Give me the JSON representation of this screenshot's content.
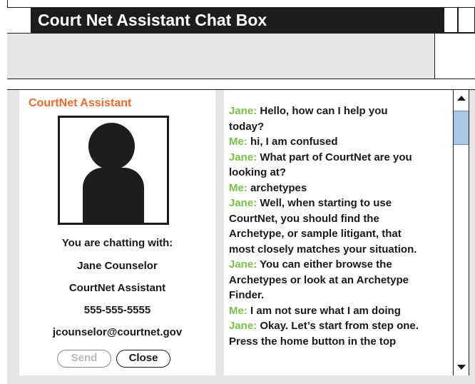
{
  "window": {
    "title": "Court Net Assistant Chat Box"
  },
  "assistant_panel": {
    "label": "CourtNet Assistant",
    "avatar_icon": "person-silhouette-icon",
    "chatting_with_label": "You are chatting with:",
    "name": "Jane Counselor",
    "role": "CourtNet Assistant",
    "phone": "555-555-5555",
    "email": "jcounselor@courtnet.gov",
    "send_label": "Send",
    "close_label": "Close",
    "send_enabled": false
  },
  "chat": {
    "lines": [
      {
        "speaker": "Jane:",
        "text": " Hello, how can I help you"
      },
      {
        "speaker": "",
        "text": "today?"
      },
      {
        "speaker": "Me:",
        "text": " hi, I am confused"
      },
      {
        "speaker": "Jane:",
        "text": " What part of CourtNet are you"
      },
      {
        "speaker": "",
        "text": "looking at?"
      },
      {
        "speaker": "Me:",
        "text": " archetypes"
      },
      {
        "speaker": "Jane:",
        "text": " Well, when starting to use"
      },
      {
        "speaker": "",
        "text": "CourtNet, you should find the"
      },
      {
        "speaker": "",
        "text": "Archetype, or sample litigant, that"
      },
      {
        "speaker": "",
        "text": "most closely matches your situation."
      },
      {
        "speaker": "Jane:",
        "text": " You can either browse the"
      },
      {
        "speaker": "",
        "text": "Archetypes or look at an Archetype"
      },
      {
        "speaker": "",
        "text": "Finder."
      },
      {
        "speaker": "Me:",
        "text": " I am not sure what I am doing"
      },
      {
        "speaker": "Jane:",
        "text": " Okay. Let’s start from step one."
      },
      {
        "speaker": "",
        "text": "Press the home button in the top"
      }
    ]
  },
  "scrollbar": {
    "up_icon": "scroll-up-arrow-icon",
    "down_icon": "scroll-down-arrow-icon"
  },
  "colors": {
    "title_bar": "#1d1d1d",
    "speaker_green": "#7cc24a",
    "assistant_orange": "#ef6a2a",
    "panel_gray": "#e6e6e6",
    "scroll_thumb": "#a9c6e6"
  }
}
